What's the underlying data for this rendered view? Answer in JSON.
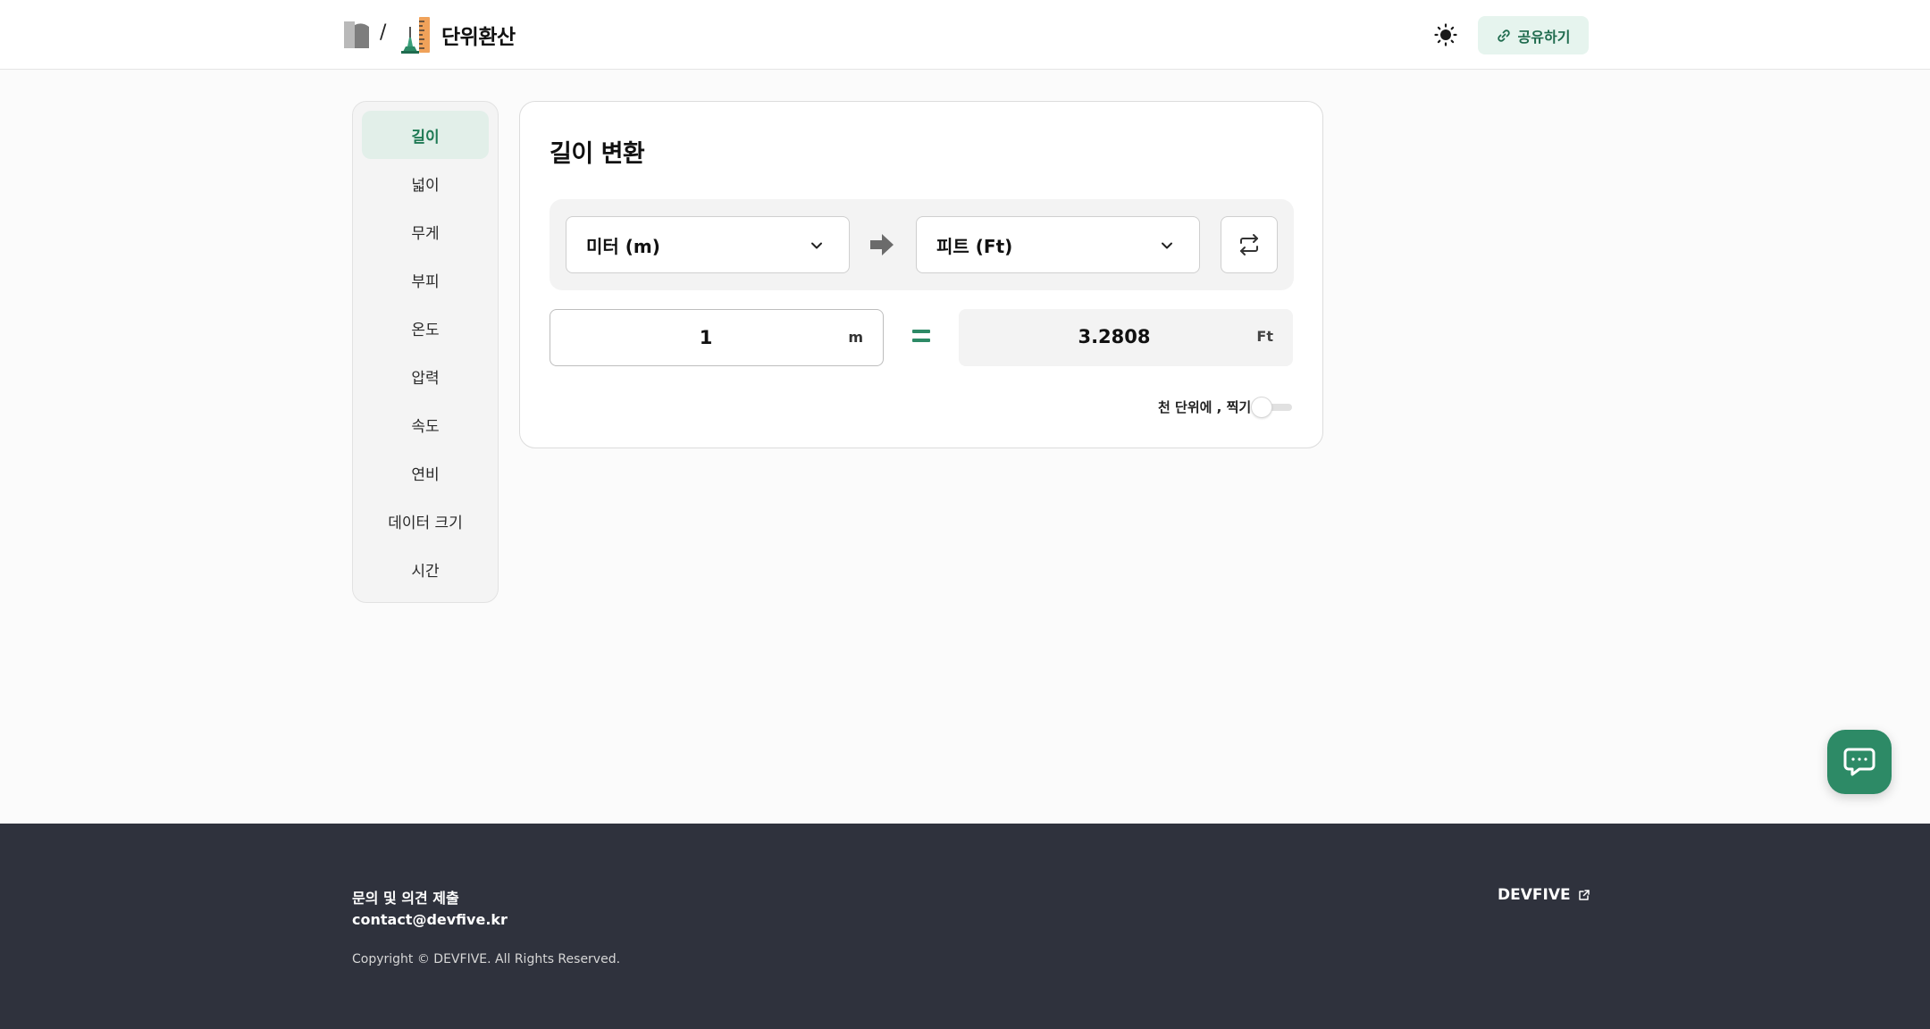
{
  "header": {
    "separator": "/",
    "app_title": "단위환산",
    "share_label": "공유하기",
    "icons": {
      "brand_logo": "devfive-logo-icon",
      "app_icon": "unit-converter-app-icon",
      "theme": "sun-icon",
      "share": "link-icon"
    }
  },
  "sidebar": {
    "items": [
      {
        "label": "길이",
        "active": true
      },
      {
        "label": "넓이"
      },
      {
        "label": "무게"
      },
      {
        "label": "부피"
      },
      {
        "label": "온도"
      },
      {
        "label": "압력"
      },
      {
        "label": "속도"
      },
      {
        "label": "연비"
      },
      {
        "label": "데이터 크기"
      },
      {
        "label": "시간"
      }
    ]
  },
  "converter": {
    "title": "길이 변환",
    "from_unit": "미터 (m)",
    "to_unit": "피트 (Ft)",
    "input_value": "1",
    "input_unit": "m",
    "output_value": "3.2808",
    "output_unit": "Ft",
    "thousands_toggle_label": "천 단위에 , 찍기",
    "thousands_toggle_on": false
  },
  "footer": {
    "inquiry_label": "문의 및 의견 제출",
    "email": "contact@devfive.kr",
    "copyright": "Copyright © DEVFIVE. All Rights Reserved.",
    "company_link": "DEVFIVE"
  },
  "colors": {
    "accent": "#2d8a66",
    "accent_light": "#e2efe9",
    "footer_bg": "#2f323d"
  }
}
